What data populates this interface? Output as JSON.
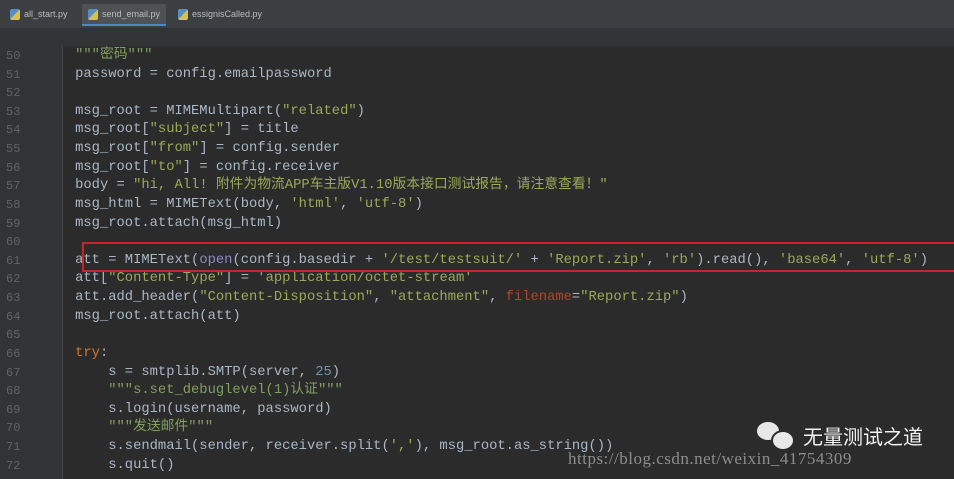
{
  "tabs": [
    {
      "label": "all_start.py",
      "active": false
    },
    {
      "label": "send_email.py",
      "active": true
    },
    {
      "label": "essignisCalled.py",
      "active": false
    }
  ],
  "lines": [
    {
      "n": "50",
      "t": [
        [
          "d",
          "    \"\"\"密码\"\"\""
        ]
      ]
    },
    {
      "n": "51",
      "t": [
        [
          "p",
          "    password = config.emailpassword"
        ]
      ]
    },
    {
      "n": "52",
      "t": []
    },
    {
      "n": "53",
      "t": [
        [
          "p",
          "    msg_root = MIMEMultipart("
        ],
        [
          "s",
          "\"related\""
        ],
        [
          "p",
          ")"
        ]
      ]
    },
    {
      "n": "54",
      "t": [
        [
          "p",
          "    msg_root["
        ],
        [
          "s",
          "\"subject\""
        ],
        [
          "p",
          "] = title"
        ]
      ]
    },
    {
      "n": "55",
      "t": [
        [
          "p",
          "    msg_root["
        ],
        [
          "s",
          "\"from\""
        ],
        [
          "p",
          "] = config.sender"
        ]
      ]
    },
    {
      "n": "56",
      "t": [
        [
          "p",
          "    msg_root["
        ],
        [
          "s",
          "\"to\""
        ],
        [
          "p",
          "] = config.receiver"
        ]
      ]
    },
    {
      "n": "57",
      "t": [
        [
          "p",
          "    body = "
        ],
        [
          "s",
          "\"hi, All! 附件为物流APP车主版V1.10版本接口测试报告，请注意查看！\""
        ]
      ]
    },
    {
      "n": "58",
      "t": [
        [
          "p",
          "    msg_html = MIMEText(body, "
        ],
        [
          "s",
          "'html'"
        ],
        [
          "p",
          ", "
        ],
        [
          "s",
          "'utf-8'"
        ],
        [
          "p",
          ")"
        ]
      ]
    },
    {
      "n": "59",
      "t": [
        [
          "p",
          "    msg_root.attach(msg_html)"
        ]
      ]
    },
    {
      "n": "60",
      "t": []
    },
    {
      "n": "61",
      "t": [
        [
          "p",
          "    att = MIMEText("
        ],
        [
          "b",
          "open"
        ],
        [
          "p",
          "(config.basedir + "
        ],
        [
          "s",
          "'/test/testsuit/'"
        ],
        [
          "p",
          " + "
        ],
        [
          "s",
          "'Report.zip'"
        ],
        [
          "p",
          ", "
        ],
        [
          "s",
          "'rb'"
        ],
        [
          "p",
          ").read(), "
        ],
        [
          "s",
          "'base64'"
        ],
        [
          "p",
          ", "
        ],
        [
          "s",
          "'utf-8'"
        ],
        [
          "p",
          ")"
        ]
      ]
    },
    {
      "n": "62",
      "t": [
        [
          "p",
          "    att["
        ],
        [
          "s",
          "\"Content-Type\""
        ],
        [
          "p",
          "] = "
        ],
        [
          "s",
          "'application/octet-stream'"
        ]
      ]
    },
    {
      "n": "63",
      "t": [
        [
          "p",
          "    att.add_header("
        ],
        [
          "s",
          "\"Content-Disposition\""
        ],
        [
          "p",
          ", "
        ],
        [
          "s",
          "\"attachment\""
        ],
        [
          "p",
          ", "
        ],
        [
          "pr",
          "filename"
        ],
        [
          "p",
          "="
        ],
        [
          "s",
          "\"Report.zip\""
        ],
        [
          "p",
          ")"
        ]
      ]
    },
    {
      "n": "64",
      "t": [
        [
          "p",
          "    msg_root.attach(att)"
        ]
      ]
    },
    {
      "n": "65",
      "t": []
    },
    {
      "n": "66",
      "t": [
        [
          "k",
          "    try"
        ],
        [
          "p",
          ":"
        ]
      ]
    },
    {
      "n": "67",
      "t": [
        [
          "p",
          "        s = smtplib.SMTP(server, "
        ],
        [
          "n",
          "25"
        ],
        [
          "p",
          ")"
        ]
      ]
    },
    {
      "n": "68",
      "t": [
        [
          "d",
          "        \"\"\"s.set_debuglevel(1)认证\"\"\""
        ]
      ]
    },
    {
      "n": "69",
      "t": [
        [
          "p",
          "        s.login(username, password)"
        ]
      ]
    },
    {
      "n": "70",
      "t": [
        [
          "d",
          "        \"\"\"发送邮件\"\"\""
        ]
      ]
    },
    {
      "n": "71",
      "t": [
        [
          "p",
          "        s.sendmail(sender, receiver.split("
        ],
        [
          "s",
          "','"
        ],
        [
          "p",
          "), msg_root.as_string())"
        ]
      ]
    },
    {
      "n": "72",
      "t": [
        [
          "p",
          "        s.quit()"
        ]
      ]
    }
  ],
  "watermark": {
    "name": "无量测试之道",
    "url": "https://blog.csdn.net/weixin_41754309"
  }
}
